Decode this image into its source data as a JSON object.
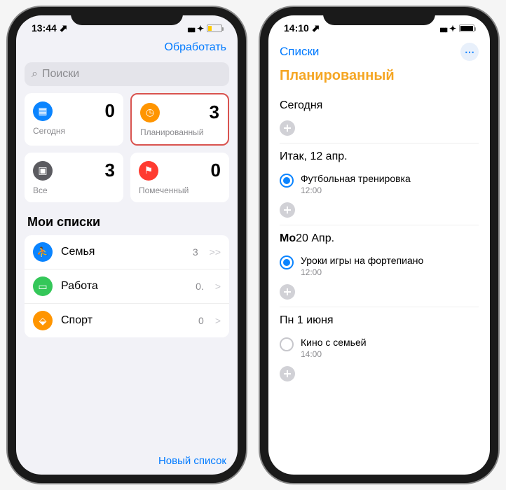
{
  "phone1": {
    "status": {
      "time": "13:44 ⬈"
    },
    "header_action": "Обработать",
    "search_placeholder": "Поиски",
    "cards": [
      {
        "label": "Сегодня",
        "count": "0"
      },
      {
        "label": "Планированный",
        "count": "3"
      },
      {
        "label": "Все",
        "count": "3"
      },
      {
        "label": "Помеченный",
        "count": "0"
      }
    ],
    "section_title": "Мои списки",
    "lists": [
      {
        "label": "Семья",
        "count": "3",
        "chev": ">>"
      },
      {
        "label": "Работа",
        "count": "0.",
        "chev": ">"
      },
      {
        "label": "Спорт",
        "count": "0",
        "chev": ">"
      }
    ],
    "footer": "Новый список"
  },
  "phone2": {
    "status": {
      "time": "14:10 ⬈"
    },
    "back": "Списки",
    "title": "Планированный",
    "days": [
      {
        "header_pre": "",
        "header": "Сегодня",
        "tasks": []
      },
      {
        "header_pre": "Итак, ",
        "header": "12 апр.",
        "tasks": [
          {
            "title": "Футбольная тренировка",
            "time": "12:00",
            "checked": true
          }
        ]
      },
      {
        "header_pre": "Mo",
        "header": "20 Апр.",
        "bold_pre": true,
        "tasks": [
          {
            "title": "Уроки игры на фортепиано",
            "time": "12:00",
            "checked": true
          }
        ]
      },
      {
        "header_pre": "Пн ",
        "header": "1 июня",
        "tasks": [
          {
            "title": "Кино с семьей",
            "time": "14:00",
            "checked": false
          }
        ]
      }
    ]
  }
}
